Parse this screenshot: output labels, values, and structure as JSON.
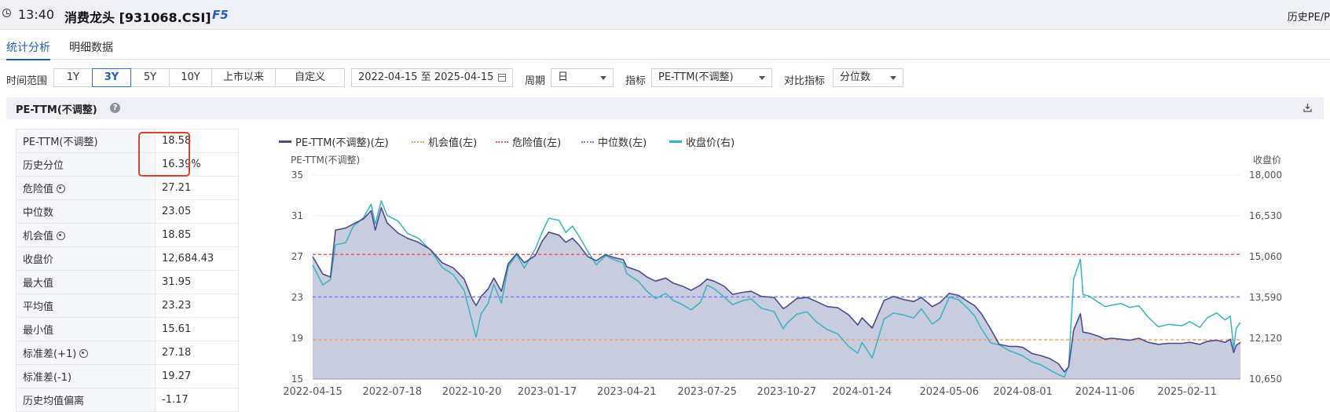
{
  "titlebar": {
    "time": "13:40",
    "name": "消费龙头 [931068.CSI]",
    "key": "F5",
    "right": "历史PE/P"
  },
  "tabs": [
    {
      "label": "统计分析"
    },
    {
      "label": "明细数据"
    }
  ],
  "filters": {
    "time_range_label": "时间范围",
    "ranges": [
      "1Y",
      "3Y",
      "5Y",
      "10Y",
      "上市以来",
      "自定义"
    ],
    "active_range": "3Y",
    "date_range": "2022-04-15 至 2025-04-15",
    "period_label": "周期",
    "period_value": "日",
    "indicator_label": "指标",
    "indicator_value": "PE-TTM(不调整)",
    "compare_label": "对比指标",
    "compare_value": "分位数"
  },
  "section": {
    "title": "PE-TTM(不调整)",
    "help_icon": "question-circle-icon",
    "download_icon": "download-icon"
  },
  "stats": [
    {
      "label": "PE-TTM(不调整)",
      "value": "18.58"
    },
    {
      "label": "历史分位",
      "value": "16.39%"
    },
    {
      "label": "危险值",
      "value": "27.21",
      "gear": true
    },
    {
      "label": "中位数",
      "value": "23.05"
    },
    {
      "label": "机会值",
      "value": "18.85",
      "gear": true
    },
    {
      "label": "收盘价",
      "value": "12,684.43"
    },
    {
      "label": "最大值",
      "value": "31.95"
    },
    {
      "label": "平均值",
      "value": "23.23"
    },
    {
      "label": "最小值",
      "value": "15.61"
    },
    {
      "label": "标准差(+1)",
      "value": "27.18",
      "gear": true
    },
    {
      "label": "标准差(-1)",
      "value": "19.27"
    },
    {
      "label": "历史均值偏离",
      "value": "-1.17"
    }
  ],
  "colors": {
    "pe": "#4a4d8c",
    "fill": "#c3c5db",
    "price": "#35b5c2",
    "danger": "#f05a5a",
    "opportunity": "#f5a25d",
    "median": "#7c86f0"
  },
  "chart_data": {
    "type": "line",
    "legend": [
      {
        "name": "PE-TTM(不调整)(左)",
        "style": "solid",
        "color": "#4a4d8c"
      },
      {
        "name": "机会值(左)",
        "style": "dashed",
        "color": "#f5a25d"
      },
      {
        "name": "危险值(左)",
        "style": "dashed",
        "color": "#f05a5a"
      },
      {
        "name": "中位数(左)",
        "style": "dashed",
        "color": "#7c86f0"
      },
      {
        "name": "收盘价(右)",
        "style": "solid",
        "color": "#35b5c2"
      }
    ],
    "ylabel_left": "PE-TTM(不调整)",
    "ylabel_right": "收盘价",
    "ylim_left": [
      15,
      35
    ],
    "ylim_right": [
      10650,
      18000
    ],
    "yticks_left": [
      "35",
      "31",
      "27",
      "23",
      "19",
      "15"
    ],
    "yticks_right": [
      "18,000",
      "16,530",
      "15,060",
      "13,590",
      "12,120",
      "10,650"
    ],
    "xlim": [
      "2022-04-15",
      "2025-04-15"
    ],
    "xticks": [
      "2022-04-15",
      "2022-07-18",
      "2022-10-20",
      "2023-01-17",
      "2023-04-21",
      "2023-07-25",
      "2023-10-27",
      "2024-01-24",
      "2024-05-06",
      "2024-08-01",
      "2024-11-06",
      "2025-02-11"
    ],
    "reference_lines": {
      "danger": 27.21,
      "median": 23.05,
      "opportunity": 18.85
    },
    "series": [
      {
        "name": "PE-TTM(不调整)",
        "axis": "left",
        "points": [
          [
            "2022-04-15",
            27.0
          ],
          [
            "2022-04-27",
            25.3
          ],
          [
            "2022-05-06",
            25.0
          ],
          [
            "2022-05-12",
            29.6
          ],
          [
            "2022-05-24",
            29.8
          ],
          [
            "2022-06-02",
            30.2
          ],
          [
            "2022-06-14",
            30.7
          ],
          [
            "2022-06-23",
            31.5
          ],
          [
            "2022-06-28",
            29.6
          ],
          [
            "2022-07-05",
            31.8
          ],
          [
            "2022-07-12",
            30.3
          ],
          [
            "2022-07-25",
            29.3
          ],
          [
            "2022-08-05",
            28.8
          ],
          [
            "2022-08-18",
            28.4
          ],
          [
            "2022-09-01",
            27.7
          ],
          [
            "2022-09-15",
            26.4
          ],
          [
            "2022-09-28",
            25.9
          ],
          [
            "2022-10-11",
            24.8
          ],
          [
            "2022-10-20",
            22.9
          ],
          [
            "2022-10-25",
            22.2
          ],
          [
            "2022-10-31",
            23.1
          ],
          [
            "2022-11-08",
            23.8
          ],
          [
            "2022-11-15",
            24.9
          ],
          [
            "2022-11-24",
            23.6
          ],
          [
            "2022-12-02",
            26.3
          ],
          [
            "2022-12-12",
            27.3
          ],
          [
            "2022-12-21",
            26.4
          ],
          [
            "2023-01-03",
            27.1
          ],
          [
            "2023-01-11",
            28.5
          ],
          [
            "2023-01-19",
            29.4
          ],
          [
            "2023-01-31",
            29.1
          ],
          [
            "2023-02-08",
            28.4
          ],
          [
            "2023-02-16",
            28.8
          ],
          [
            "2023-02-24",
            28.1
          ],
          [
            "2023-03-06",
            27.0
          ],
          [
            "2023-03-16",
            26.6
          ],
          [
            "2023-03-27",
            27.2
          ],
          [
            "2023-04-06",
            26.9
          ],
          [
            "2023-04-17",
            26.7
          ],
          [
            "2023-04-21",
            26.0
          ],
          [
            "2023-05-05",
            25.6
          ],
          [
            "2023-05-15",
            25.0
          ],
          [
            "2023-05-25",
            24.6
          ],
          [
            "2023-06-06",
            24.9
          ],
          [
            "2023-06-15",
            24.4
          ],
          [
            "2023-06-26",
            24.1
          ],
          [
            "2023-07-06",
            23.7
          ],
          [
            "2023-07-17",
            24.2
          ],
          [
            "2023-07-25",
            24.8
          ],
          [
            "2023-08-02",
            24.6
          ],
          [
            "2023-08-14",
            24.1
          ],
          [
            "2023-08-24",
            23.3
          ],
          [
            "2023-09-05",
            23.5
          ],
          [
            "2023-09-15",
            23.6
          ],
          [
            "2023-09-27",
            23.1
          ],
          [
            "2023-10-12",
            23.0
          ],
          [
            "2023-10-23",
            21.9
          ],
          [
            "2023-10-27",
            22.1
          ],
          [
            "2023-11-08",
            22.9
          ],
          [
            "2023-11-20",
            23.0
          ],
          [
            "2023-12-01",
            22.6
          ],
          [
            "2023-12-14",
            22.1
          ],
          [
            "2023-12-26",
            22.0
          ],
          [
            "2024-01-08",
            21.3
          ],
          [
            "2024-01-19",
            20.3
          ],
          [
            "2024-01-24",
            21.0
          ],
          [
            "2024-02-05",
            20.0
          ],
          [
            "2024-02-19",
            22.7
          ],
          [
            "2024-03-01",
            23.1
          ],
          [
            "2024-03-13",
            22.8
          ],
          [
            "2024-03-25",
            22.6
          ],
          [
            "2024-04-03",
            23.0
          ],
          [
            "2024-04-16",
            22.1
          ],
          [
            "2024-04-25",
            22.5
          ],
          [
            "2024-05-06",
            23.4
          ],
          [
            "2024-05-17",
            23.2
          ],
          [
            "2024-05-28",
            22.6
          ],
          [
            "2024-06-05",
            22.2
          ],
          [
            "2024-06-13",
            21.4
          ],
          [
            "2024-06-24",
            19.9
          ],
          [
            "2024-07-04",
            18.4
          ],
          [
            "2024-07-16",
            18.2
          ],
          [
            "2024-07-25",
            18.2
          ],
          [
            "2024-08-01",
            18.1
          ],
          [
            "2024-08-12",
            17.5
          ],
          [
            "2024-08-22",
            17.3
          ],
          [
            "2024-09-02",
            17.0
          ],
          [
            "2024-09-12",
            16.5
          ],
          [
            "2024-09-19",
            15.7
          ],
          [
            "2024-09-24",
            16.2
          ],
          [
            "2024-09-30",
            19.8
          ],
          [
            "2024-10-08",
            21.4
          ],
          [
            "2024-10-11",
            19.6
          ],
          [
            "2024-10-18",
            19.5
          ],
          [
            "2024-10-29",
            19.2
          ],
          [
            "2024-11-06",
            18.9
          ],
          [
            "2024-11-14",
            19.0
          ],
          [
            "2024-11-25",
            18.9
          ],
          [
            "2024-12-05",
            18.8
          ],
          [
            "2024-12-16",
            19.0
          ],
          [
            "2024-12-27",
            18.6
          ],
          [
            "2025-01-08",
            18.4
          ],
          [
            "2025-01-20",
            18.5
          ],
          [
            "2025-02-05",
            18.5
          ],
          [
            "2025-02-14",
            18.6
          ],
          [
            "2025-02-26",
            18.4
          ],
          [
            "2025-03-07",
            18.7
          ],
          [
            "2025-03-18",
            18.8
          ],
          [
            "2025-03-28",
            18.6
          ],
          [
            "2025-04-03",
            18.9
          ],
          [
            "2025-04-07",
            17.6
          ],
          [
            "2025-04-10",
            18.3
          ],
          [
            "2025-04-15",
            18.6
          ]
        ]
      },
      {
        "name": "收盘价",
        "axis": "right",
        "points": [
          [
            "2022-04-15",
            14760
          ],
          [
            "2022-04-27",
            14040
          ],
          [
            "2022-05-06",
            14230
          ],
          [
            "2022-05-12",
            15490
          ],
          [
            "2022-05-24",
            15560
          ],
          [
            "2022-06-02",
            16150
          ],
          [
            "2022-06-14",
            16460
          ],
          [
            "2022-06-23",
            16950
          ],
          [
            "2022-06-28",
            16230
          ],
          [
            "2022-07-05",
            17070
          ],
          [
            "2022-07-12",
            16540
          ],
          [
            "2022-07-25",
            16340
          ],
          [
            "2022-08-05",
            15900
          ],
          [
            "2022-08-18",
            15720
          ],
          [
            "2022-09-01",
            15300
          ],
          [
            "2022-09-15",
            14670
          ],
          [
            "2022-09-28",
            14410
          ],
          [
            "2022-10-11",
            13840
          ],
          [
            "2022-10-20",
            12750
          ],
          [
            "2022-10-25",
            12150
          ],
          [
            "2022-10-31",
            13000
          ],
          [
            "2022-11-08",
            13360
          ],
          [
            "2022-11-15",
            14060
          ],
          [
            "2022-11-24",
            13390
          ],
          [
            "2022-12-02",
            14700
          ],
          [
            "2022-12-12",
            15130
          ],
          [
            "2022-12-21",
            14650
          ],
          [
            "2023-01-03",
            15340
          ],
          [
            "2023-01-11",
            15930
          ],
          [
            "2023-01-19",
            16440
          ],
          [
            "2023-01-31",
            16370
          ],
          [
            "2023-02-08",
            15930
          ],
          [
            "2023-02-16",
            16160
          ],
          [
            "2023-02-24",
            15780
          ],
          [
            "2023-03-06",
            15250
          ],
          [
            "2023-03-16",
            14770
          ],
          [
            "2023-03-27",
            15090
          ],
          [
            "2023-04-06",
            14950
          ],
          [
            "2023-04-17",
            14830
          ],
          [
            "2023-04-21",
            14450
          ],
          [
            "2023-05-05",
            14160
          ],
          [
            "2023-05-15",
            13810
          ],
          [
            "2023-05-25",
            13550
          ],
          [
            "2023-06-06",
            13730
          ],
          [
            "2023-06-15",
            13480
          ],
          [
            "2023-06-26",
            13330
          ],
          [
            "2023-07-06",
            13140
          ],
          [
            "2023-07-17",
            13410
          ],
          [
            "2023-07-25",
            14030
          ],
          [
            "2023-08-02",
            13910
          ],
          [
            "2023-08-14",
            13610
          ],
          [
            "2023-08-24",
            13330
          ],
          [
            "2023-09-05",
            13470
          ],
          [
            "2023-09-15",
            13540
          ],
          [
            "2023-09-27",
            13200
          ],
          [
            "2023-10-12",
            13080
          ],
          [
            "2023-10-23",
            12460
          ],
          [
            "2023-10-27",
            12650
          ],
          [
            "2023-11-08",
            12990
          ],
          [
            "2023-11-20",
            13070
          ],
          [
            "2023-12-01",
            12710
          ],
          [
            "2023-12-14",
            12430
          ],
          [
            "2023-12-26",
            12280
          ],
          [
            "2024-01-08",
            11830
          ],
          [
            "2024-01-19",
            11580
          ],
          [
            "2024-01-24",
            11970
          ],
          [
            "2024-02-05",
            11410
          ],
          [
            "2024-02-19",
            12810
          ],
          [
            "2024-03-01",
            13030
          ],
          [
            "2024-03-13",
            12960
          ],
          [
            "2024-03-25",
            12850
          ],
          [
            "2024-04-03",
            13180
          ],
          [
            "2024-04-16",
            12630
          ],
          [
            "2024-04-25",
            12830
          ],
          [
            "2024-05-06",
            13600
          ],
          [
            "2024-05-17",
            13510
          ],
          [
            "2024-05-28",
            13190
          ],
          [
            "2024-06-05",
            12930
          ],
          [
            "2024-06-13",
            12460
          ],
          [
            "2024-06-24",
            11950
          ],
          [
            "2024-07-04",
            11880
          ],
          [
            "2024-07-16",
            11670
          ],
          [
            "2024-07-25",
            11570
          ],
          [
            "2024-08-01",
            11480
          ],
          [
            "2024-08-12",
            11260
          ],
          [
            "2024-08-22",
            11170
          ],
          [
            "2024-09-02",
            10970
          ],
          [
            "2024-09-12",
            10810
          ],
          [
            "2024-09-19",
            10720
          ],
          [
            "2024-09-24",
            11120
          ],
          [
            "2024-09-30",
            14260
          ],
          [
            "2024-10-08",
            14960
          ],
          [
            "2024-10-11",
            13690
          ],
          [
            "2024-10-18",
            13640
          ],
          [
            "2024-10-29",
            13420
          ],
          [
            "2024-11-06",
            13260
          ],
          [
            "2024-11-14",
            13310
          ],
          [
            "2024-11-25",
            13370
          ],
          [
            "2024-12-05",
            13230
          ],
          [
            "2024-12-16",
            13290
          ],
          [
            "2024-12-27",
            12880
          ],
          [
            "2025-01-08",
            12530
          ],
          [
            "2025-01-20",
            12620
          ],
          [
            "2025-02-05",
            12570
          ],
          [
            "2025-02-14",
            12720
          ],
          [
            "2025-02-26",
            12510
          ],
          [
            "2025-03-07",
            12860
          ],
          [
            "2025-03-18",
            13030
          ],
          [
            "2025-03-28",
            12780
          ],
          [
            "2025-04-03",
            12920
          ],
          [
            "2025-04-07",
            11740
          ],
          [
            "2025-04-10",
            12480
          ],
          [
            "2025-04-15",
            12684
          ]
        ]
      }
    ]
  }
}
